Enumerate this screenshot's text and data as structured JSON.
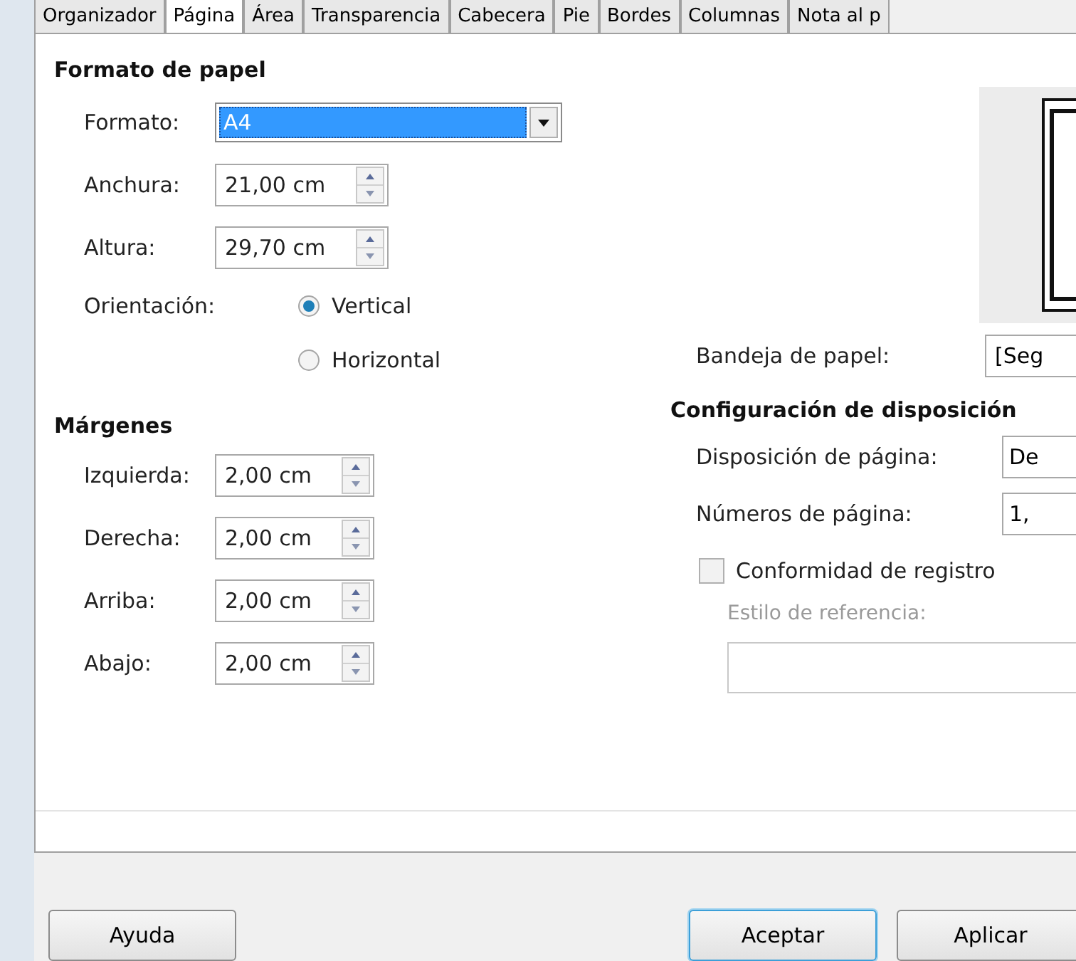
{
  "tabs": [
    {
      "label": "Organizador",
      "selected": false
    },
    {
      "label": "Página",
      "selected": true
    },
    {
      "label": "Área",
      "selected": false
    },
    {
      "label": "Transparencia",
      "selected": false
    },
    {
      "label": "Cabecera",
      "selected": false
    },
    {
      "label": "Pie",
      "selected": false
    },
    {
      "label": "Bordes",
      "selected": false
    },
    {
      "label": "Columnas",
      "selected": false
    },
    {
      "label": "Nota al p",
      "selected": false
    }
  ],
  "paper_format": {
    "title": "Formato de papel",
    "format": {
      "label": "Formato:",
      "value": "A4"
    },
    "width": {
      "label": "Anchura:",
      "value": "21,00 cm"
    },
    "height": {
      "label": "Altura:",
      "value": "29,70 cm"
    },
    "orientation": {
      "label": "Orientación:",
      "options": [
        {
          "label": "Vertical",
          "selected": true
        },
        {
          "label": "Horizontal",
          "selected": false
        }
      ]
    },
    "paper_tray": {
      "label": "Bandeja de papel:",
      "value": "[Seg"
    }
  },
  "margins": {
    "title": "Márgenes",
    "fields": [
      {
        "label": "Izquierda:",
        "value": "2,00 cm"
      },
      {
        "label": "Derecha:",
        "value": "2,00 cm"
      },
      {
        "label": "Arriba:",
        "value": "2,00 cm"
      },
      {
        "label": "Abajo:",
        "value": "2,00 cm"
      }
    ]
  },
  "layout_settings": {
    "title": "Configuración de disposición",
    "page_layout": {
      "label": "Disposición de página:",
      "value": "De"
    },
    "page_numbers": {
      "label": "Números de página:",
      "value": "1,"
    },
    "register_true": {
      "label": "Conformidad de registro",
      "checked": false
    },
    "reference_style": {
      "label": "Estilo de referencia:",
      "disabled": true
    }
  },
  "buttons": [
    {
      "label": "Ayuda",
      "default": false
    },
    {
      "label": "Aceptar",
      "default": true
    },
    {
      "label": "Aplicar",
      "default": false
    }
  ]
}
